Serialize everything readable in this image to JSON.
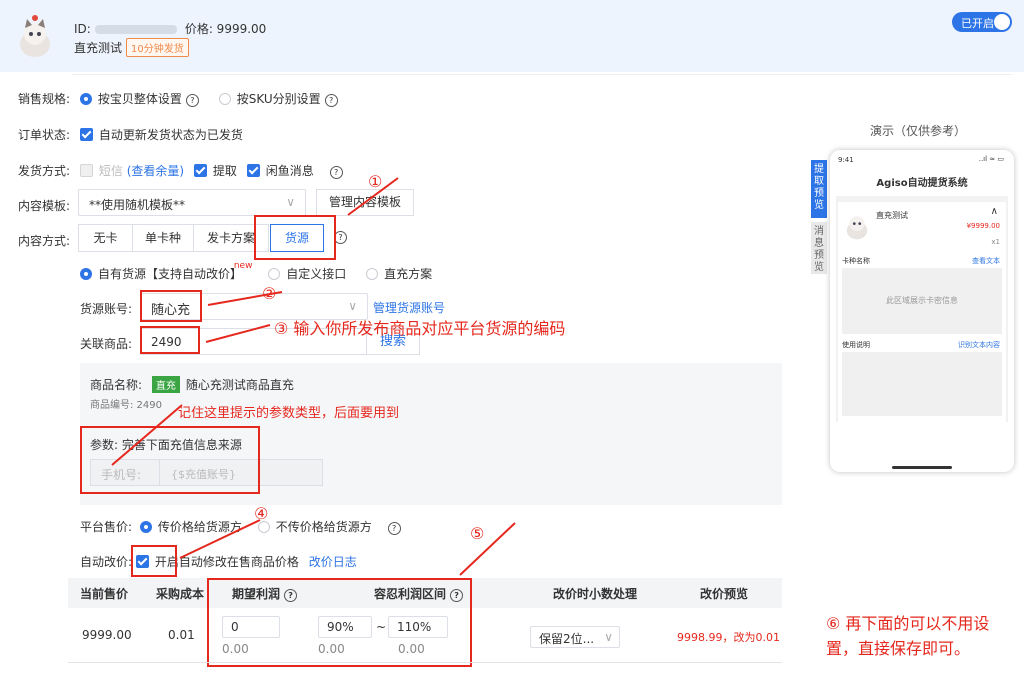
{
  "header": {
    "id_label": "ID:",
    "price": "价格: 9999.00",
    "product_name": "直充测试",
    "ship_tag": "10分钟发货",
    "toggle_label": "已开启"
  },
  "form": {
    "spec_label": "销售规格:",
    "spec_opt1": "按宝贝整体设置",
    "spec_opt2": "按SKU分别设置",
    "order_label": "订单状态:",
    "order_opt": "自动更新发货状态为已发货",
    "ship_label": "发货方式:",
    "ship_sms": "短信",
    "ship_check_balance": "(查看余量)",
    "ship_pickup": "提取",
    "ship_xianyu": "闲鱼消息",
    "template_label": "内容模板:",
    "template_value": "**使用随机模板**",
    "template_manage": "管理内容模板",
    "content_label": "内容方式:",
    "content_tabs": [
      "无卡",
      "单卡种",
      "发卡方案",
      "货源"
    ],
    "source_opt1": "自有货源【支持自动改价】",
    "source_new": "new",
    "source_opt2": "自定义接口",
    "source_opt3": "直充方案",
    "account_label": "货源账号:",
    "account_value": "随心充",
    "account_manage": "管理货源账号",
    "linked_label": "关联商品:",
    "linked_value": "2490",
    "search_btn": "搜索",
    "goods_name_label": "商品名称:",
    "goods_tag": "直充",
    "goods_name": "随心充测试商品直充",
    "goods_no": "商品编号: 2490",
    "param_label": "参数: 完善下面充值信息来源",
    "param_field": "手机号:",
    "param_value": "{$充值账号}",
    "price_label": "平台售价:",
    "price_opt1": "传价格给货源方",
    "price_opt2": "不传价格给货源方",
    "auto_label": "自动改价:",
    "auto_opt": "开启自动修改在售商品价格",
    "auto_log": "改价日志"
  },
  "table": {
    "headers": [
      "当前售价",
      "采购成本",
      "期望利润",
      "容忍利润区间",
      "改价时小数处理",
      "改价预览"
    ],
    "row": {
      "price": "9999.00",
      "cost": "0.01",
      "profit_input": "0",
      "profit_sub": "0.00",
      "range_low": "90%",
      "range_sep": "~",
      "range_high": "110%",
      "range_low_sub": "0.00",
      "range_high_sub": "0.00",
      "decimal": "保留2位...",
      "preview": "9998.99，改为0.01"
    }
  },
  "annotations": {
    "n1": "①",
    "n2": "②",
    "n3": "③ 输入你所发布商品对应平台货源的编码",
    "remember": "记住这里提示的参数类型，后面要用到",
    "n4": "④",
    "n5": "⑤",
    "n6_line1": "⑥ 再下面的可以不用设",
    "n6_line2": "置，直接保存即可。"
  },
  "preview": {
    "title": "演示（仅供参考）",
    "tab1": "提取预览",
    "tab2": "消息预览",
    "time": "9:41",
    "status": "..ıl ≈ ▭",
    "app_title": "Agiso自动提货系统",
    "item_name": "直充测试",
    "item_price": "¥9999.00",
    "item_qty": "x1",
    "card_label": "卡种名称",
    "card_link": "查看文本",
    "card_area": "此区域展示卡密信息",
    "usage_label": "使用说明",
    "usage_link": "识别文本内容"
  }
}
